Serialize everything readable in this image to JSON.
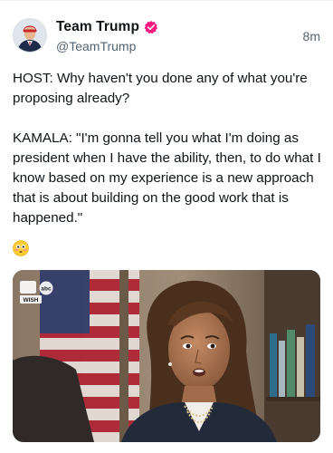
{
  "tweet": {
    "display_name": "Team Trump",
    "handle": "@TeamTrump",
    "timestamp": "8m",
    "paragraphs": [
      "HOST: Why haven't you done any of what you're proposing already?",
      "KAMALA: \"I'm gonna tell you what I'm doing as president when I have the ability, then, to do what I know based on my experience is a new approach that is about building on the good work that is happened.\""
    ],
    "emoji": "flushed-face-emoji"
  },
  "media": {
    "channel_logo_top": "abc",
    "channel_logo_bottom": "WISH"
  },
  "icons": {
    "verified": "verified-badge-icon",
    "avatar": "profile-avatar"
  },
  "colors": {
    "verified_badge": "#f91880",
    "secondary_text": "#536471",
    "primary_text": "#0f1419"
  }
}
